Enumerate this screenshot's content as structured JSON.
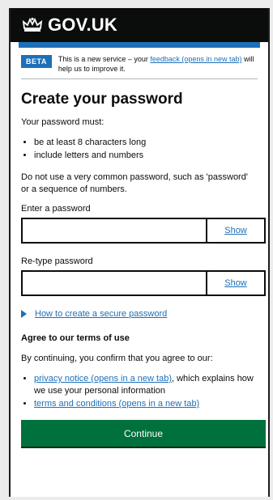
{
  "header": {
    "brand": "GOV.UK"
  },
  "phase_banner": {
    "tag": "BETA",
    "text_before": "This is a new service – your ",
    "link": "feedback (opens in new tab)",
    "text_after": " will help us to improve it."
  },
  "page": {
    "title": "Create your password",
    "intro": "Your password must:",
    "rules": [
      "be at least 8 characters long",
      "include letters and numbers"
    ],
    "warning": "Do not use a very common password, such as 'password' or a sequence of numbers."
  },
  "fields": {
    "password": {
      "label": "Enter a password",
      "value": "",
      "show_label": "Show"
    },
    "retype": {
      "label": "Re-type password",
      "value": "",
      "show_label": "Show"
    }
  },
  "details": {
    "summary": "How to create a secure password"
  },
  "terms": {
    "heading": "Agree to our terms of use",
    "intro": "By continuing, you confirm that you agree to our:",
    "privacy_link": "privacy notice (opens in a new tab)",
    "privacy_suffix": ", which explains how we use your personal information",
    "conditions_link": "terms and conditions (opens in a new tab)"
  },
  "actions": {
    "continue": "Continue"
  }
}
